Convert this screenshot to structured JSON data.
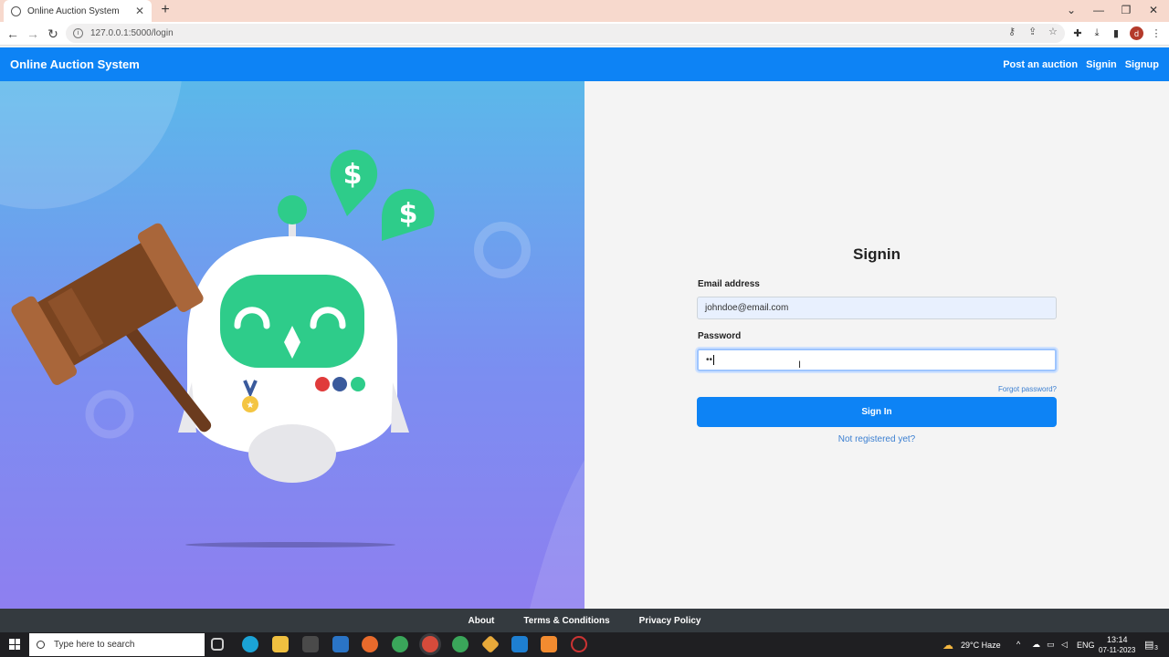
{
  "browser": {
    "tab_title": "Online Auction System",
    "tab_close": "✕",
    "new_tab": "+",
    "url": "127.0.0.1:5000/login",
    "profile_initial": "d"
  },
  "navbar": {
    "brand": "Online Auction System",
    "links": [
      "Post an auction",
      "Signin",
      "Signup"
    ]
  },
  "form": {
    "title": "Signin",
    "email_label": "Email address",
    "email_value": "johndoe@email.com",
    "password_label": "Password",
    "password_value": "••",
    "forgot_link": "Forgot password?",
    "submit_label": "Sign In",
    "register_link": "Not registered yet?"
  },
  "footer": {
    "links": [
      "About",
      "Terms & Conditions",
      "Privacy Policy"
    ]
  },
  "taskbar": {
    "search_placeholder": "Type here to search",
    "weather": "29°C  Haze",
    "language": "ENG",
    "time": "13:14",
    "date": "07-11-2023",
    "notification_count": "3"
  },
  "colors": {
    "primary": "#0d83f5",
    "footer": "#343a3f",
    "link": "#3b7fd1",
    "robot_green": "#2ecc8a"
  }
}
